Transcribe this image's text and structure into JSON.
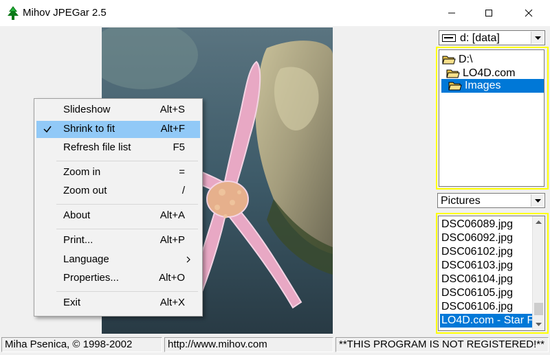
{
  "window": {
    "title": "Mihov JPEGar 2.5"
  },
  "drive_combo": {
    "value": "d: [data]"
  },
  "folder_tree": [
    {
      "label": "D:\\",
      "selected": false
    },
    {
      "label": "LO4D.com",
      "selected": false
    },
    {
      "label": "Images",
      "selected": true
    }
  ],
  "filter_combo": {
    "value": "Pictures"
  },
  "files": [
    {
      "name": "DSC06089.jpg",
      "selected": false
    },
    {
      "name": "DSC06092.jpg",
      "selected": false
    },
    {
      "name": "DSC06102.jpg",
      "selected": false
    },
    {
      "name": "DSC06103.jpg",
      "selected": false
    },
    {
      "name": "DSC06104.jpg",
      "selected": false
    },
    {
      "name": "DSC06105.jpg",
      "selected": false
    },
    {
      "name": "DSC06106.jpg",
      "selected": false
    },
    {
      "name": "LO4D.com - Star F",
      "selected": true
    }
  ],
  "status": {
    "author": "Miha Psenica, © 1998-2002",
    "url": "http://www.mihov.com",
    "registration": "**THIS PROGRAM IS NOT REGISTERED!**"
  },
  "menu": {
    "slideshow": {
      "label": "Slideshow",
      "key": "Alt+S"
    },
    "shrink": {
      "label": "Shrink to fit",
      "key": "Alt+F",
      "checked": true
    },
    "refresh": {
      "label": "Refresh file list",
      "key": "F5"
    },
    "zoom_in": {
      "label": "Zoom in",
      "key": "="
    },
    "zoom_out": {
      "label": "Zoom out",
      "key": "/"
    },
    "about": {
      "label": "About",
      "key": "Alt+A"
    },
    "print": {
      "label": "Print...",
      "key": "Alt+P"
    },
    "language": {
      "label": "Language",
      "key": ""
    },
    "properties": {
      "label": "Properties...",
      "key": "Alt+O"
    },
    "exit": {
      "label": "Exit",
      "key": "Alt+X"
    }
  },
  "colors": {
    "highlight": "#91c9f7",
    "selection": "#0078d7",
    "frame": "#ffff00"
  }
}
